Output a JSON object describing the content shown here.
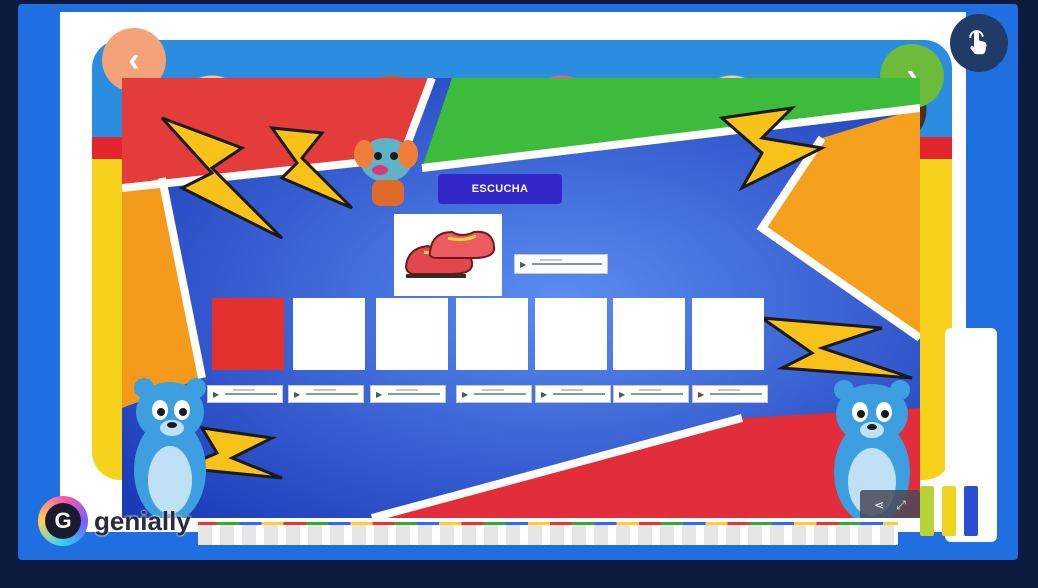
{
  "stage": {
    "prev_icon": "chevron-left-icon",
    "next_icon": "chevron-right-icon",
    "prev_glyph": "‹",
    "next_glyph": "›",
    "touch_icon": "hand-pointer-icon"
  },
  "activity": {
    "title": "ESCUCHA",
    "picture": "shoes",
    "tiles": [
      {
        "state": "filled",
        "color": "#e4302e"
      },
      {
        "state": "empty"
      },
      {
        "state": "empty"
      },
      {
        "state": "empty"
      },
      {
        "state": "empty"
      },
      {
        "state": "empty"
      },
      {
        "state": "empty"
      }
    ],
    "audio_players": 8
  },
  "controls": {
    "share_icon": "share-icon",
    "fullscreen_icon": "fullscreen-icon",
    "share_glyph": "⋖",
    "fullscreen_glyph": "⤢"
  },
  "brand": {
    "logo_letter": "G",
    "name": "genially"
  },
  "colors": {
    "frame": "#1f6fe0",
    "title_bg": "#3427c7",
    "filled_tile": "#e4302e",
    "page_bg": "#0b1a3d"
  }
}
